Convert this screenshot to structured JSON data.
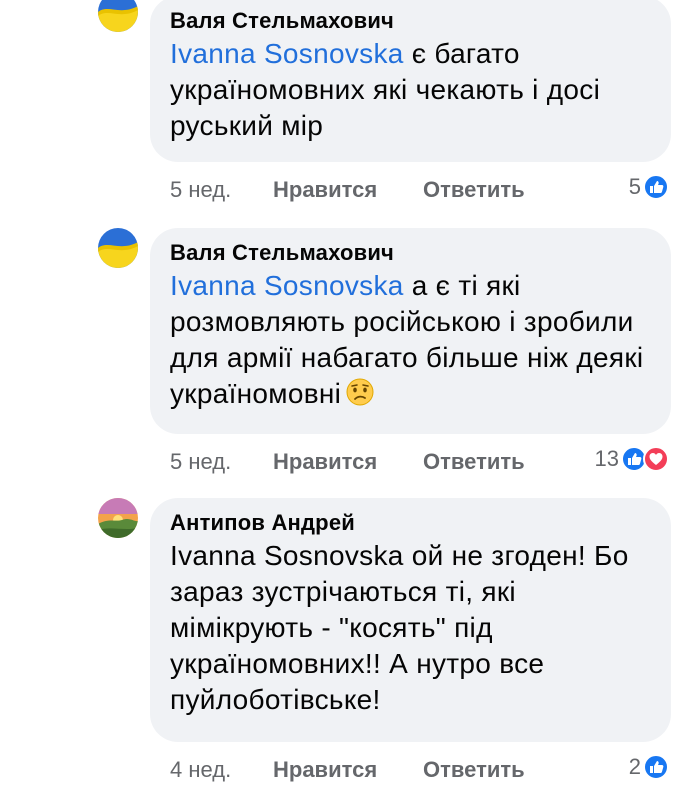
{
  "comments": [
    {
      "author": "Валя Стельмахович",
      "mention": "Ivanna Sosnovska",
      "text": " є багато україномовних які чекають і досі руський мір",
      "time": "5 нед.",
      "like_label": "Нравится",
      "reply_label": "Ответить",
      "reaction_count": "5",
      "reactions": [
        "like-icon"
      ]
    },
    {
      "author": "Валя Стельмахович",
      "mention": "Ivanna Sosnovska",
      "text": " а є ті які розмовляють російською і зробили для армії набагато більше ніж деякі україномовні",
      "emoji": "worried-face-icon",
      "time": "5 нед.",
      "like_label": "Нравится",
      "reply_label": "Ответить",
      "reaction_count": "13",
      "reactions": [
        "like-icon",
        "love-icon"
      ]
    },
    {
      "author": "Антипов Андрей",
      "mention": "Ivanna Sosnovska",
      "text": " ой не згоден! Бо зараз зустрічаються ті, які мімікрують - \"косять\" під україномовних!! А нутро все пуйлоботівське!",
      "time": "4 нед.",
      "like_label": "Нравится",
      "reply_label": "Ответить",
      "reaction_count": "2",
      "reactions": [
        "like-icon"
      ]
    }
  ],
  "colors": {
    "bubble": "#f0f2f5",
    "mention": "#216fdb",
    "meta": "#65676b",
    "like": "#1877f2",
    "love": "#f33e58"
  }
}
